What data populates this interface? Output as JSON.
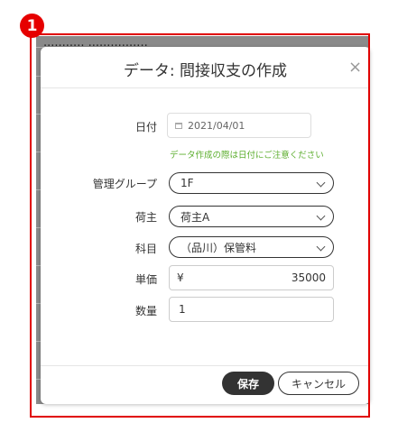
{
  "step_number": "1",
  "background": {
    "top_text": "...........    ................",
    "bottom_text": "..............................."
  },
  "dialog": {
    "title": "データ: 間接収支の作成",
    "close_symbol": "×",
    "date": {
      "label": "日付",
      "value": "2021/04/01",
      "hint": "データ作成の際は日付にご注意ください"
    },
    "group": {
      "label": "管理グループ",
      "value": "1F"
    },
    "shipper": {
      "label": "荷主",
      "value": "荷主A"
    },
    "subject": {
      "label": "科目",
      "value": "（品川）保管料"
    },
    "unit_price": {
      "label": "単価",
      "prefix": "¥",
      "value": "35000"
    },
    "quantity": {
      "label": "数量",
      "value": "1"
    },
    "buttons": {
      "save": "保存",
      "cancel": "キャンセル"
    }
  }
}
